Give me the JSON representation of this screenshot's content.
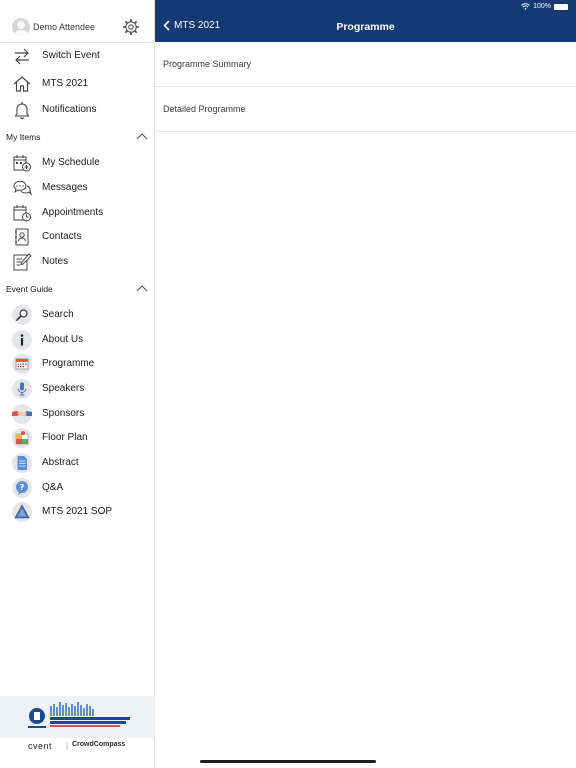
{
  "status": {
    "battery": "100%"
  },
  "profile": {
    "name": "Demo Attendee"
  },
  "nav_top": [
    {
      "label": "Switch Event",
      "icon": "switch-icon"
    },
    {
      "label": "MTS 2021",
      "icon": "home-icon"
    },
    {
      "label": "Notifications",
      "icon": "bell-icon"
    }
  ],
  "my_items": {
    "heading": "My Items",
    "items": [
      {
        "label": "My Schedule",
        "icon": "schedule-icon"
      },
      {
        "label": "Messages",
        "icon": "messages-icon"
      },
      {
        "label": "Appointments",
        "icon": "appointments-icon"
      },
      {
        "label": "Contacts",
        "icon": "contacts-icon"
      },
      {
        "label": "Notes",
        "icon": "notes-icon"
      }
    ]
  },
  "event_guide": {
    "heading": "Event Guide",
    "items": [
      {
        "label": "Search",
        "icon": "search-icon"
      },
      {
        "label": "About Us",
        "icon": "info-icon"
      },
      {
        "label": "Programme",
        "icon": "calendar-icon"
      },
      {
        "label": "Speakers",
        "icon": "microphone-icon"
      },
      {
        "label": "Sponsors",
        "icon": "handshake-icon"
      },
      {
        "label": "Floor Plan",
        "icon": "floor-plan-icon"
      },
      {
        "label": "Abstract",
        "icon": "document-icon"
      },
      {
        "label": "Q&A",
        "icon": "question-icon"
      },
      {
        "label": "MTS 2021 SOP",
        "icon": "warning-triangle-icon"
      }
    ]
  },
  "footer": {
    "cvent": "cvent",
    "separator": "|",
    "crowdcompass": "CrowdCompass"
  },
  "header": {
    "back_label": "MTS 2021",
    "title": "Programme",
    "color": "#143a73"
  },
  "main": {
    "rows": [
      {
        "label": "Programme Summary"
      },
      {
        "label": "Detailed Programme"
      }
    ]
  }
}
